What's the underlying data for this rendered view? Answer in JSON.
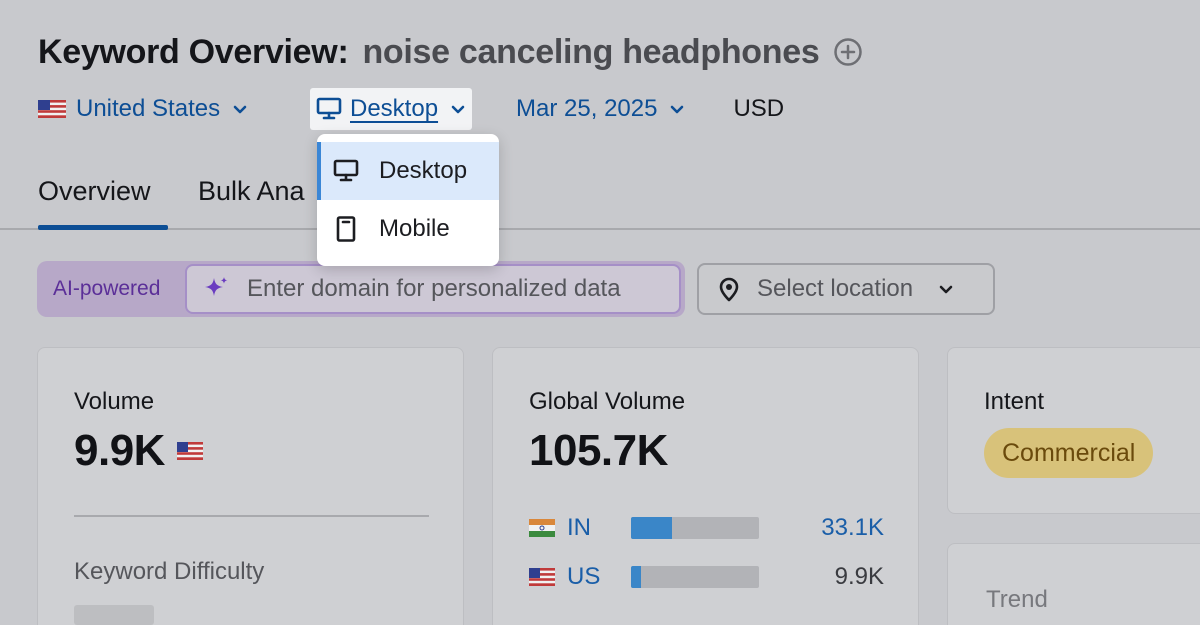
{
  "header": {
    "title_label": "Keyword Overview:",
    "keyword": "noise canceling headphones"
  },
  "filters": {
    "country": "United States",
    "device": "Desktop",
    "date": "Mar 25, 2025",
    "currency": "USD"
  },
  "tabs": [
    {
      "label": "Overview",
      "active": true
    },
    {
      "label": "Bulk Ana"
    }
  ],
  "device_menu": {
    "items": [
      {
        "label": "Desktop",
        "icon": "desktop-icon",
        "selected": true
      },
      {
        "label": "Mobile",
        "icon": "mobile-icon"
      }
    ]
  },
  "ai": {
    "badge": "AI-powered",
    "placeholder": "Enter domain for personalized data",
    "location_placeholder": "Select location"
  },
  "volume_card": {
    "title": "Volume",
    "value": "9.9K",
    "kd_label": "Keyword Difficulty"
  },
  "global_card": {
    "title": "Global Volume",
    "value": "105.7K",
    "rows": [
      {
        "code": "IN",
        "value": "33.1K",
        "share": 0.32,
        "highlight": true
      },
      {
        "code": "US",
        "value": "9.9K",
        "share": 0.08,
        "highlight": false
      }
    ]
  },
  "intent_card": {
    "title": "Intent",
    "badge": "Commercial"
  },
  "trend_card": {
    "title": "Trend"
  },
  "colors": {
    "accent": "#0d4e95",
    "intent_badge": "#d8c27a",
    "ai_purple": "#5b2f98"
  }
}
